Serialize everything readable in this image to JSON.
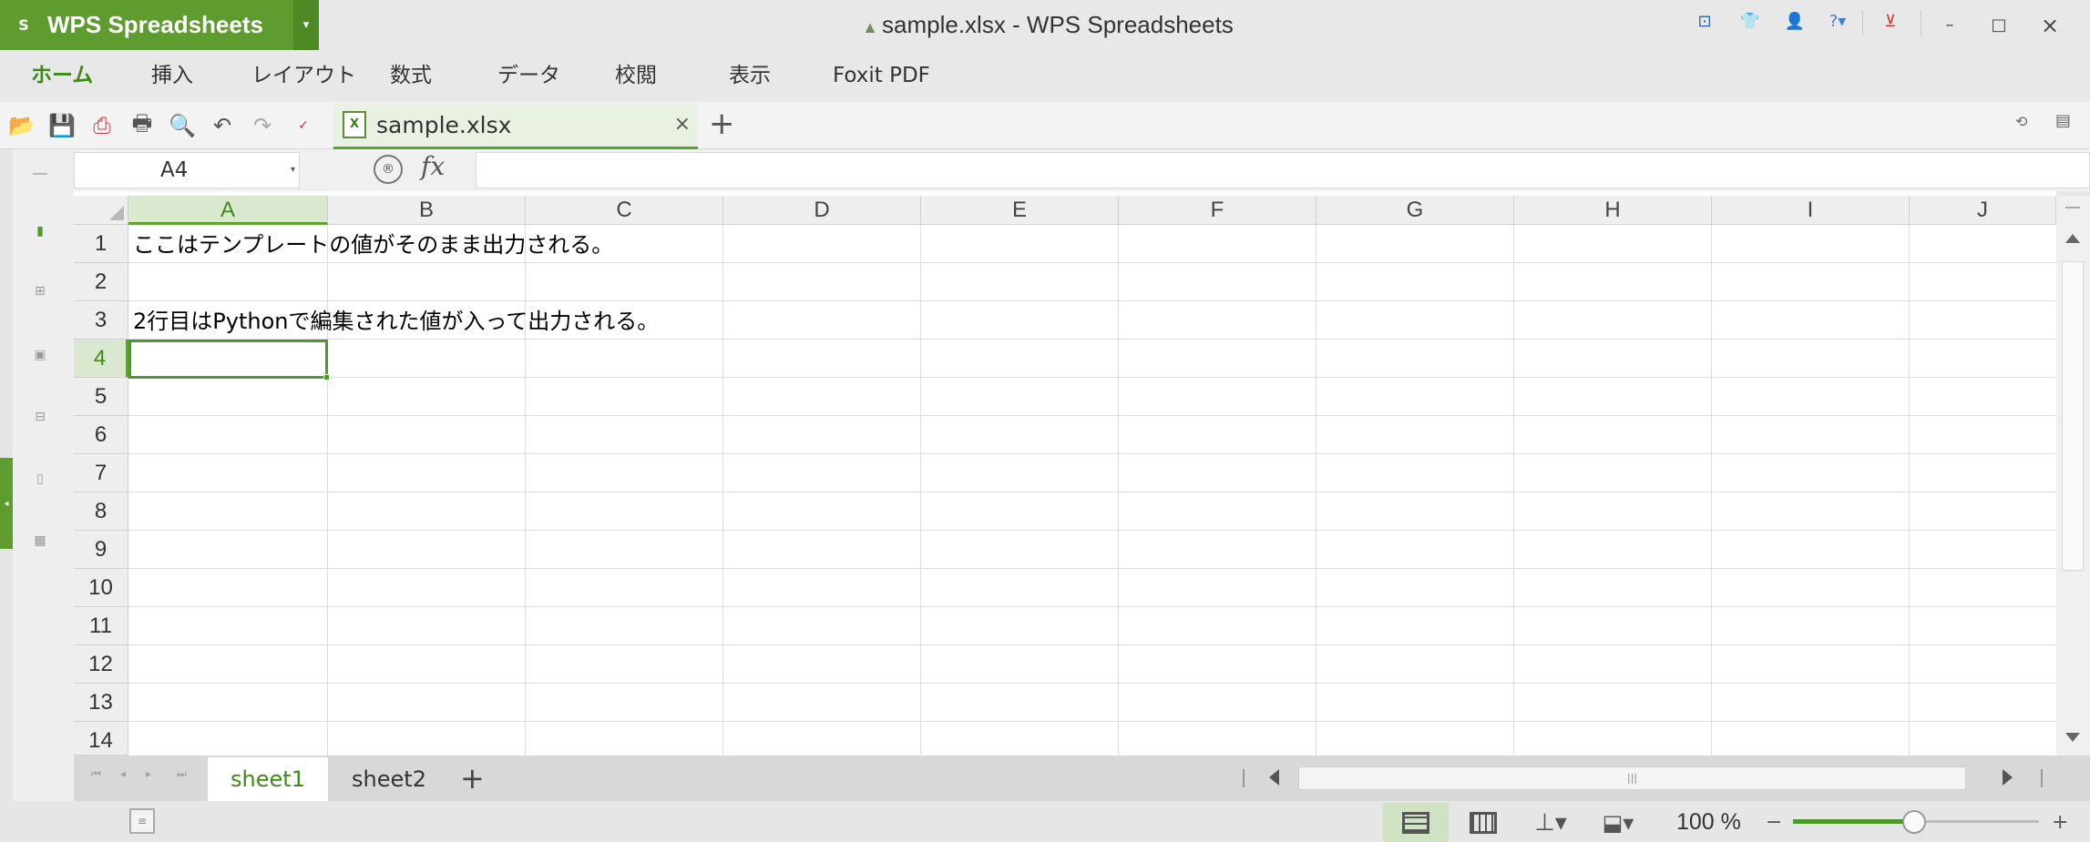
{
  "app": {
    "menu_logo": "S",
    "name": "WPS Spreadsheets",
    "window_title": "sample.xlsx - WPS Spreadsheets"
  },
  "window_controls": {
    "minimize": "–",
    "maximize": "□",
    "close": "×"
  },
  "menu_tabs": [
    "ホーム",
    "挿入",
    "レイアウト",
    "数式",
    "データ",
    "校閲",
    "表示",
    "Foxit PDF"
  ],
  "document_tab": {
    "name": "sample.xlsx",
    "close": "×",
    "new_tab": "+"
  },
  "formula_bar": {
    "name_box": "A4",
    "fx": "fx",
    "formula": ""
  },
  "columns": [
    "A",
    "B",
    "C",
    "D",
    "E",
    "F",
    "G",
    "H",
    "I",
    "J"
  ],
  "rows": [
    "1",
    "2",
    "3",
    "4",
    "5",
    "6",
    "7",
    "8",
    "9",
    "10",
    "11",
    "12",
    "13",
    "14"
  ],
  "cells": {
    "A1": "ここはテンプレートの値がそのまま出力される。",
    "A3": "2行目はPythonで編集された値が入って出力される。"
  },
  "selected_cell": "A4",
  "sheets": [
    "sheet1",
    "sheet2"
  ],
  "active_sheet": "sheet1",
  "add_sheet": "+",
  "status": {
    "zoom_label": "100 %",
    "zoom_minus": "−",
    "zoom_plus": "+",
    "zoom_level": 100
  },
  "colors": {
    "brand_green": "#5e9c2f",
    "selection_green": "#4c9a2a",
    "header_select": "#d9e8cf"
  }
}
